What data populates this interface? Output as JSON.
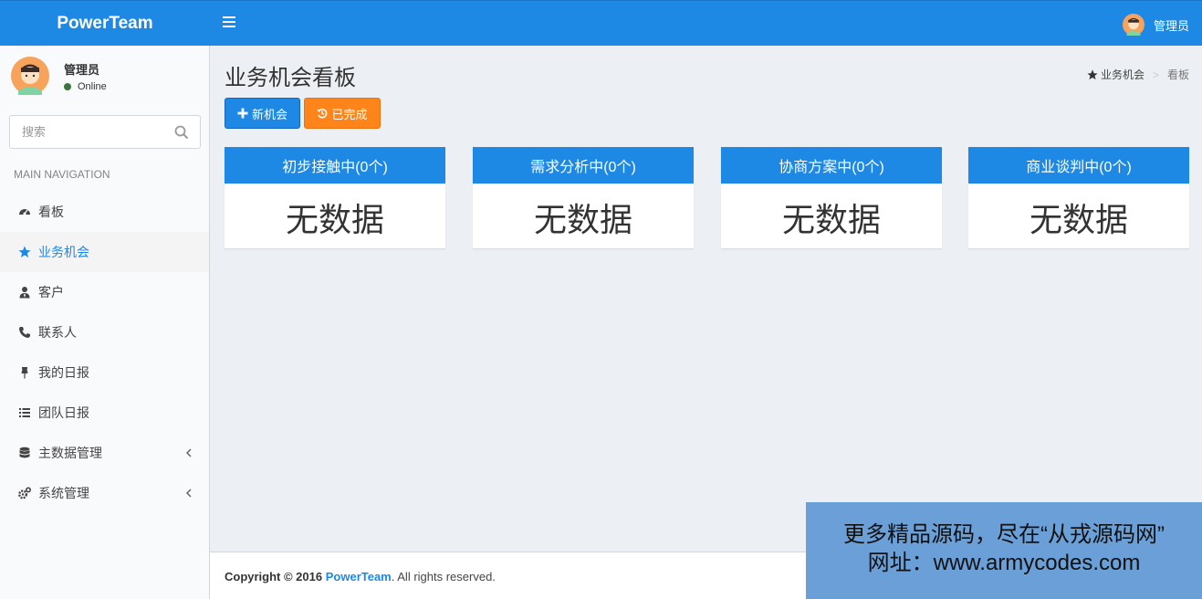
{
  "header": {
    "brand": "PowerTeam",
    "user_name": "管理员"
  },
  "sidebar": {
    "user": {
      "name": "管理员",
      "status": "Online"
    },
    "search": {
      "placeholder": "搜索"
    },
    "nav_header": "MAIN NAVIGATION",
    "items": [
      {
        "label": "看板",
        "icon": "dashboard-icon"
      },
      {
        "label": "业务机会",
        "icon": "star-icon",
        "active": true
      },
      {
        "label": "客户",
        "icon": "user-tie-icon"
      },
      {
        "label": "联系人",
        "icon": "phone-icon"
      },
      {
        "label": "我的日报",
        "icon": "pin-icon"
      },
      {
        "label": "团队日报",
        "icon": "list-icon"
      },
      {
        "label": "主数据管理",
        "icon": "database-icon",
        "has_submenu": true
      },
      {
        "label": "系统管理",
        "icon": "cogs-icon",
        "has_submenu": true
      }
    ]
  },
  "main": {
    "title": "业务机会看板",
    "breadcrumb": {
      "parent": "业务机会",
      "current": "看板",
      "separator": ">"
    },
    "buttons": {
      "new": "新机会",
      "done": "已完成"
    },
    "columns": [
      {
        "title": "初步接触中(0个)",
        "body": "无数据"
      },
      {
        "title": "需求分析中(0个)",
        "body": "无数据"
      },
      {
        "title": "协商方案中(0个)",
        "body": "无数据"
      },
      {
        "title": "商业谈判中(0个)",
        "body": "无数据"
      }
    ]
  },
  "footer": {
    "copyright": "Copyright © 2016",
    "brand": "PowerTeam",
    "rights": ". All rights reserved."
  },
  "watermark": {
    "line1": "更多精品源码，尽在“从戎源码网”",
    "line2": "网址：www.armycodes.com"
  },
  "colors": {
    "primary": "#1e88e5",
    "warning": "#ff851b",
    "background": "#ecf0f5",
    "sidebar": "#f9fafc"
  }
}
